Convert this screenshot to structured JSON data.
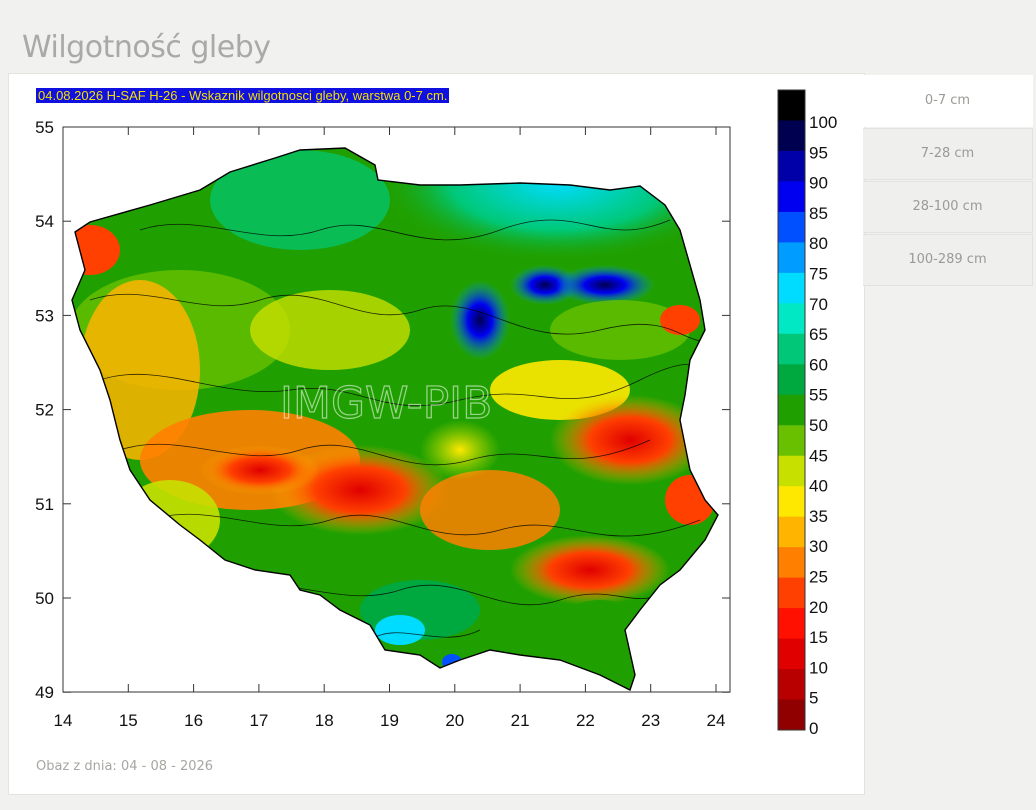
{
  "page": {
    "title": "Wilgotność gleby"
  },
  "map": {
    "caption": "04.08.2026 H-SAF H-26 - Wskaznik wilgotnosci gleby, warstwa 0-7 cm.",
    "watermark": "IMGW-PIB",
    "x_ticks": [
      "14",
      "15",
      "16",
      "17",
      "18",
      "19",
      "20",
      "21",
      "22",
      "23",
      "24"
    ],
    "y_ticks": [
      "55",
      "54",
      "53",
      "52",
      "51",
      "50",
      "49"
    ],
    "legend": {
      "labels": [
        "100",
        "95",
        "90",
        "85",
        "80",
        "75",
        "70",
        "65",
        "60",
        "55",
        "50",
        "45",
        "40",
        "35",
        "30",
        "25",
        "20",
        "15",
        "10",
        "5",
        "0"
      ],
      "colors": [
        "#000000",
        "#000050",
        "#0000a8",
        "#0000f0",
        "#0050ff",
        "#009cff",
        "#00dcff",
        "#00e8c4",
        "#00c878",
        "#00a840",
        "#20a000",
        "#68c000",
        "#c8e000",
        "#ffe800",
        "#ffb400",
        "#ff8000",
        "#ff4000",
        "#ff1000",
        "#e00000",
        "#b80000",
        "#900000"
      ]
    },
    "icon": "soil-moisture-map-icon"
  },
  "date_note": "Obaz z dnia: 04 - 08 - 2026",
  "tabs": [
    {
      "label": "0-7 cm",
      "active": true
    },
    {
      "label": "7-28 cm",
      "active": false
    },
    {
      "label": "28-100 cm",
      "active": false
    },
    {
      "label": "100-289 cm",
      "active": false
    }
  ]
}
